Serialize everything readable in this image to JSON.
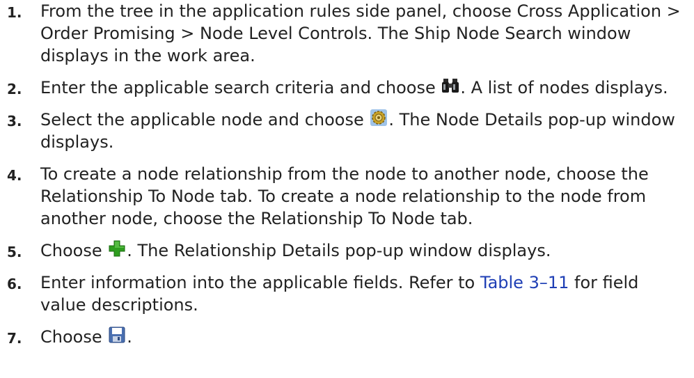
{
  "steps": [
    {
      "number": "1.",
      "text": "From the tree in the application rules side panel, choose Cross Application > Order Promising > Node Level Controls. The Ship Node Search window displays in the work area."
    },
    {
      "number": "2.",
      "before": "Enter the applicable search criteria and choose ",
      "icon": "binoculars-icon",
      "after": ". A list of nodes displays."
    },
    {
      "number": "3.",
      "before": "Select the applicable node and choose ",
      "icon": "details-gear-icon",
      "after": ". The Node Details pop-up window displays."
    },
    {
      "number": "4.",
      "text": "To create a node relationship from the node to another node, choose the Relationship To Node tab. To create a node relationship to the node from another node, choose the Relationship To Node tab."
    },
    {
      "number": "5.",
      "before": "Choose ",
      "icon": "green-plus-icon",
      "after": ". The Relationship Details pop-up window displays."
    },
    {
      "number": "6.",
      "before": "Enter information into the applicable fields. Refer to ",
      "link": "Table 3–11",
      "after": " for field value descriptions."
    },
    {
      "number": "7.",
      "before": "Choose ",
      "icon": "save-disk-icon",
      "after": "."
    }
  ],
  "colors": {
    "text": "#222222",
    "link": "#1f3fb5",
    "plus_green": "#2e9e1f",
    "disk_blue": "#4a6fb0"
  }
}
